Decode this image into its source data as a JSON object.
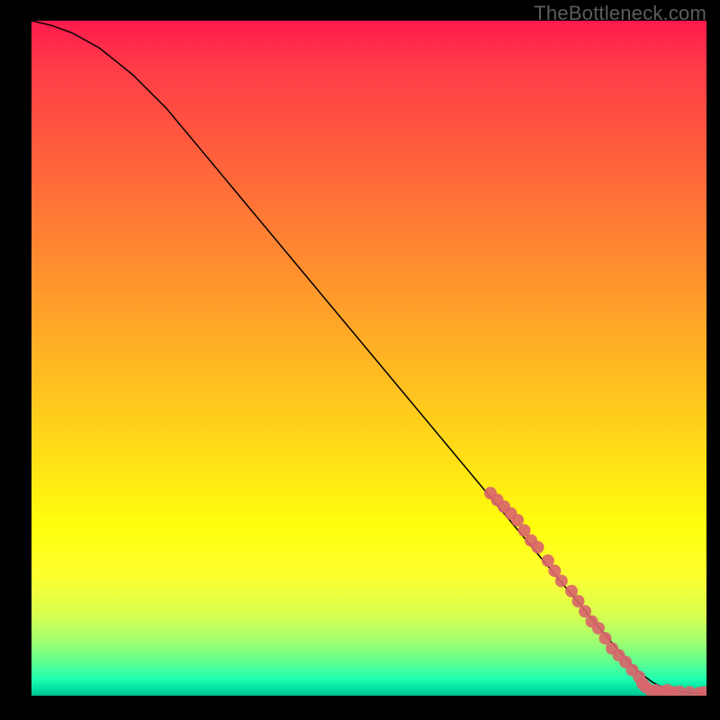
{
  "watermark": "TheBottleneck.com",
  "chart_data": {
    "type": "line",
    "title": "",
    "xlabel": "",
    "ylabel": "",
    "xlim": [
      0,
      100
    ],
    "ylim": [
      0,
      100
    ],
    "series": [
      {
        "name": "curve",
        "x": [
          0,
          3,
          6,
          10,
          15,
          20,
          30,
          40,
          50,
          60,
          70,
          75,
          80,
          85,
          88,
          90,
          92,
          94,
          96,
          98,
          100
        ],
        "y": [
          100,
          99.3,
          98.2,
          96,
          92,
          87,
          75,
          63,
          51,
          39,
          27,
          21,
          15,
          9,
          5.5,
          3.5,
          2.0,
          1.0,
          0.6,
          0.4,
          0.3
        ]
      }
    ],
    "points": [
      {
        "x": 68,
        "y": 30
      },
      {
        "x": 69,
        "y": 29
      },
      {
        "x": 70,
        "y": 28
      },
      {
        "x": 71,
        "y": 27
      },
      {
        "x": 72,
        "y": 26
      },
      {
        "x": 73,
        "y": 24.5
      },
      {
        "x": 74,
        "y": 23
      },
      {
        "x": 75,
        "y": 22
      },
      {
        "x": 76.5,
        "y": 20
      },
      {
        "x": 77.5,
        "y": 18.5
      },
      {
        "x": 78.5,
        "y": 17
      },
      {
        "x": 80,
        "y": 15.5
      },
      {
        "x": 81,
        "y": 14
      },
      {
        "x": 82,
        "y": 12.5
      },
      {
        "x": 83,
        "y": 11
      },
      {
        "x": 84,
        "y": 10
      },
      {
        "x": 85,
        "y": 8.5
      },
      {
        "x": 86,
        "y": 7
      },
      {
        "x": 87,
        "y": 6
      },
      {
        "x": 88,
        "y": 5
      },
      {
        "x": 89,
        "y": 3.8
      },
      {
        "x": 90,
        "y": 2.8
      },
      {
        "x": 90.5,
        "y": 1.8
      },
      {
        "x": 91,
        "y": 1.3
      },
      {
        "x": 91.8,
        "y": 0.7
      },
      {
        "x": 92.5,
        "y": 0.8
      },
      {
        "x": 93.5,
        "y": 0.6
      },
      {
        "x": 94.2,
        "y": 0.8
      },
      {
        "x": 95,
        "y": 0.5
      },
      {
        "x": 96,
        "y": 0.6
      },
      {
        "x": 97.5,
        "y": 0.5
      },
      {
        "x": 99,
        "y": 0.4
      },
      {
        "x": 99.7,
        "y": 0.5
      }
    ],
    "gradient_desc": "vertical red→yellow→green"
  }
}
